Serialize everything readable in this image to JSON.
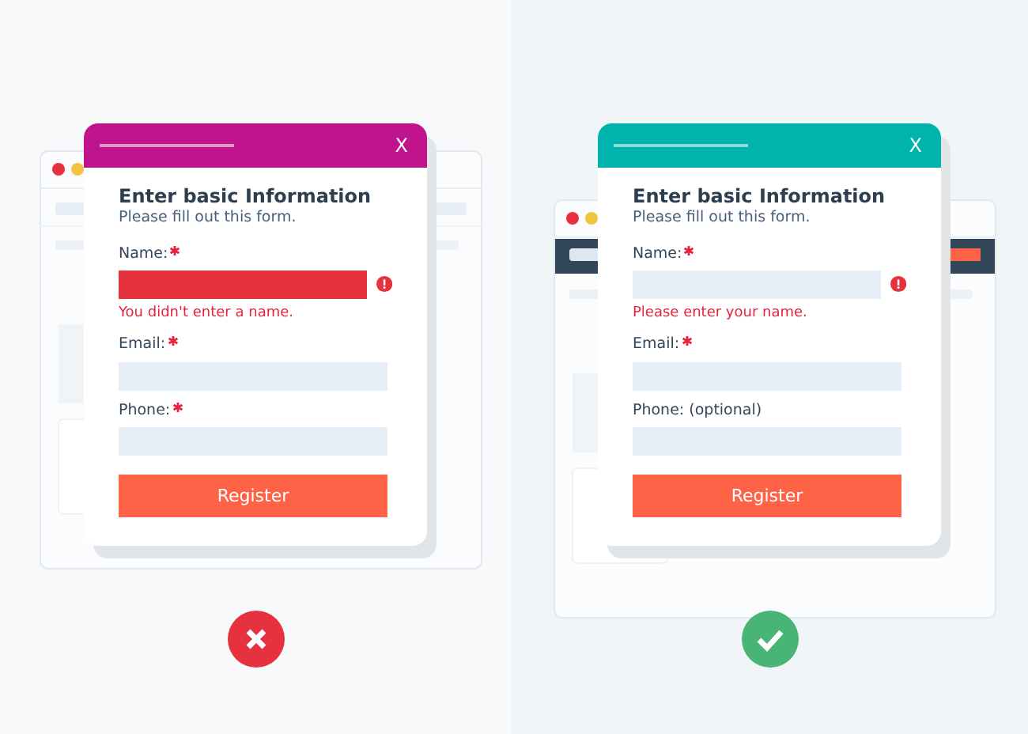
{
  "examples": [
    {
      "kind": "bad",
      "color": "#c0148c",
      "background_window": {
        "navbar": false
      },
      "dialog": {
        "close": "X",
        "title": "Enter basic Information",
        "subtitle": "Please fill out this form.",
        "button": "Register",
        "fields": [
          {
            "label": "Name:",
            "required": true,
            "error_fill": true,
            "error": "You didn't enter a name."
          },
          {
            "label": "Email:",
            "required": true
          },
          {
            "label": "Phone:",
            "required": true
          }
        ]
      }
    },
    {
      "kind": "good",
      "color": "#00b3ad",
      "background_window": {
        "navbar": true
      },
      "dialog": {
        "close": "X",
        "title": "Enter basic Information",
        "subtitle": "Please fill out this form.",
        "button": "Register",
        "fields": [
          {
            "label": "Name:",
            "required": true,
            "error_fill": false,
            "error": "Please enter your name."
          },
          {
            "label": "Email:",
            "required": true
          },
          {
            "label": "Phone: (optional)",
            "required": false
          }
        ]
      }
    }
  ]
}
